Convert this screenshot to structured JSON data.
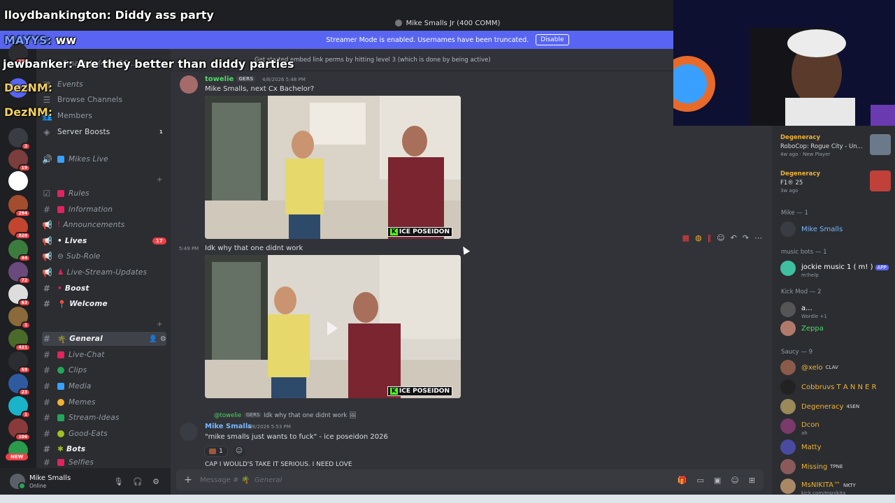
{
  "window": {
    "title": "Mike Smalls Jr (400 COMM)"
  },
  "banner": {
    "text": "Streamer Mode is enabled. Usernames have been truncated.",
    "button": "Disable"
  },
  "header": {
    "topic": "Get started embed link perms by hitting level 3 (which is done by being active)",
    "server_name": "Mike Smalls Jr (400 CO..."
  },
  "overlay_chat": [
    {
      "user": "lloydbankington:",
      "text": "Diddy ass party"
    },
    {
      "user": "MAYYS:",
      "text": "ww"
    },
    {
      "user": "jewbanker:",
      "text": "Are they better than diddy parties"
    },
    {
      "user": "DezNM:",
      "text": ""
    },
    {
      "user": "DezNM:",
      "text": ""
    }
  ],
  "sidebar": {
    "top_items": [
      "Events",
      "Browse Channels",
      "Members",
      "Server Boosts"
    ],
    "server_boosts_count": "1",
    "channels": [
      {
        "name": "Mikes Live",
        "icon": "speaker",
        "bold": false
      },
      {
        "name": "Rules",
        "icon": "check",
        "bold": false
      },
      {
        "name": "Information",
        "icon": "hash",
        "bold": false
      },
      {
        "name": "Announcements",
        "icon": "megaphone",
        "bold": false
      },
      {
        "name": "Lives",
        "icon": "megaphone",
        "bold": true,
        "count": "17"
      },
      {
        "name": "Sub-Role",
        "icon": "megaphone",
        "bold": false
      },
      {
        "name": "Live-Stream-Updates",
        "icon": "megaphone",
        "bold": false
      },
      {
        "name": "Boost",
        "icon": "hash",
        "bold": true
      },
      {
        "name": "Welcome",
        "icon": "hash",
        "bold": true
      },
      {
        "name": "General",
        "icon": "hash",
        "bold": true,
        "selected": true
      },
      {
        "name": "Live-Chat",
        "icon": "hash",
        "bold": false
      },
      {
        "name": "Clips",
        "icon": "hash",
        "bold": false
      },
      {
        "name": "Media",
        "icon": "hash",
        "bold": false
      },
      {
        "name": "Memes",
        "icon": "hash",
        "bold": false
      },
      {
        "name": "Stream-Ideas",
        "icon": "hash",
        "bold": false
      },
      {
        "name": "Good-Eats",
        "icon": "hash",
        "bold": false
      },
      {
        "name": "Bots",
        "icon": "hash",
        "bold": true
      },
      {
        "name": "Selfies",
        "icon": "hash",
        "bold": false
      }
    ]
  },
  "rail_badges": [
    "107",
    "2",
    "19",
    "294",
    "820",
    "44",
    "72",
    "63",
    "1",
    "421",
    "59",
    "23",
    "1",
    "106"
  ],
  "rail_new": "NEW",
  "user_panel": {
    "name": "Mike Smalls",
    "status": "Online"
  },
  "messages": [
    {
      "user": "towelie",
      "tag": "GERS",
      "time": "4/8/2026 5:48 PM",
      "text": "Mike Smalls, next Cx Bachelor?",
      "watermark": "ICE POSEIDON"
    },
    {
      "time": "5:49 PM",
      "text": "Idk why that one didnt work",
      "watermark": "ICE POSEIDON"
    },
    {
      "reply_user": "@towelie",
      "reply_tag": "GERS",
      "reply_text": "Idk why that one didnt work",
      "user": "Mike Smalls",
      "time": "4/8/2026 5:53 PM",
      "text": "\"mike smalls just wants to fuck\" - ice poseidon 2026",
      "reaction_count": "1",
      "next_text": "CAP I WOULD'S TAKE IT SERIOUS. I NEED LOVE"
    }
  ],
  "composer": {
    "placeholder": "Message #",
    "channel": "General"
  },
  "members": {
    "activities": [
      {
        "user": "Degeneracy",
        "game": "RoboCop: Rogue City - Un...",
        "when": "4w ago",
        "extra": "New Player"
      },
      {
        "user": "Degeneracy",
        "game": "F1® 25",
        "when": "3w ago"
      }
    ],
    "groups": [
      {
        "title": "Mike — 1",
        "members": [
          {
            "name": "Mike Smalls",
            "color": "#79b8ff"
          }
        ]
      },
      {
        "title": "music bots — 1",
        "members": [
          {
            "name": "jockie music 1 ( m! )",
            "color": "#ffffff",
            "pill": "APP",
            "sub": "m!help"
          }
        ]
      },
      {
        "title": "Kick Mod — 2",
        "members": [
          {
            "name": "a...",
            "color": "#ffffff",
            "sub": "Wordle +1"
          },
          {
            "name": "Zeppa",
            "color": "#4cd964"
          }
        ]
      },
      {
        "title": "Saucy — 9",
        "members": [
          {
            "name": "@xelo",
            "color": "#f0b232",
            "tag": "CLAV"
          },
          {
            "name": "Cobbruvs T A N N E R",
            "color": "#f0b232"
          },
          {
            "name": "Degeneracy",
            "color": "#f0b232",
            "tag": "4SEN"
          },
          {
            "name": "Dcon",
            "color": "#f0b232",
            "sub": "ah"
          },
          {
            "name": "Matty",
            "color": "#f0b232"
          },
          {
            "name": "Missing",
            "color": "#f0b232",
            "tag": "TPNE"
          },
          {
            "name": "MsNIKITA™",
            "color": "#f0b232",
            "tag": "NKTY",
            "sub": "kick.com/msnikita"
          }
        ]
      }
    ]
  },
  "colors": {
    "accent": "#5865f2",
    "bg": "#313338",
    "sidebar": "#2b2d31",
    "rail": "#1e1f22"
  }
}
